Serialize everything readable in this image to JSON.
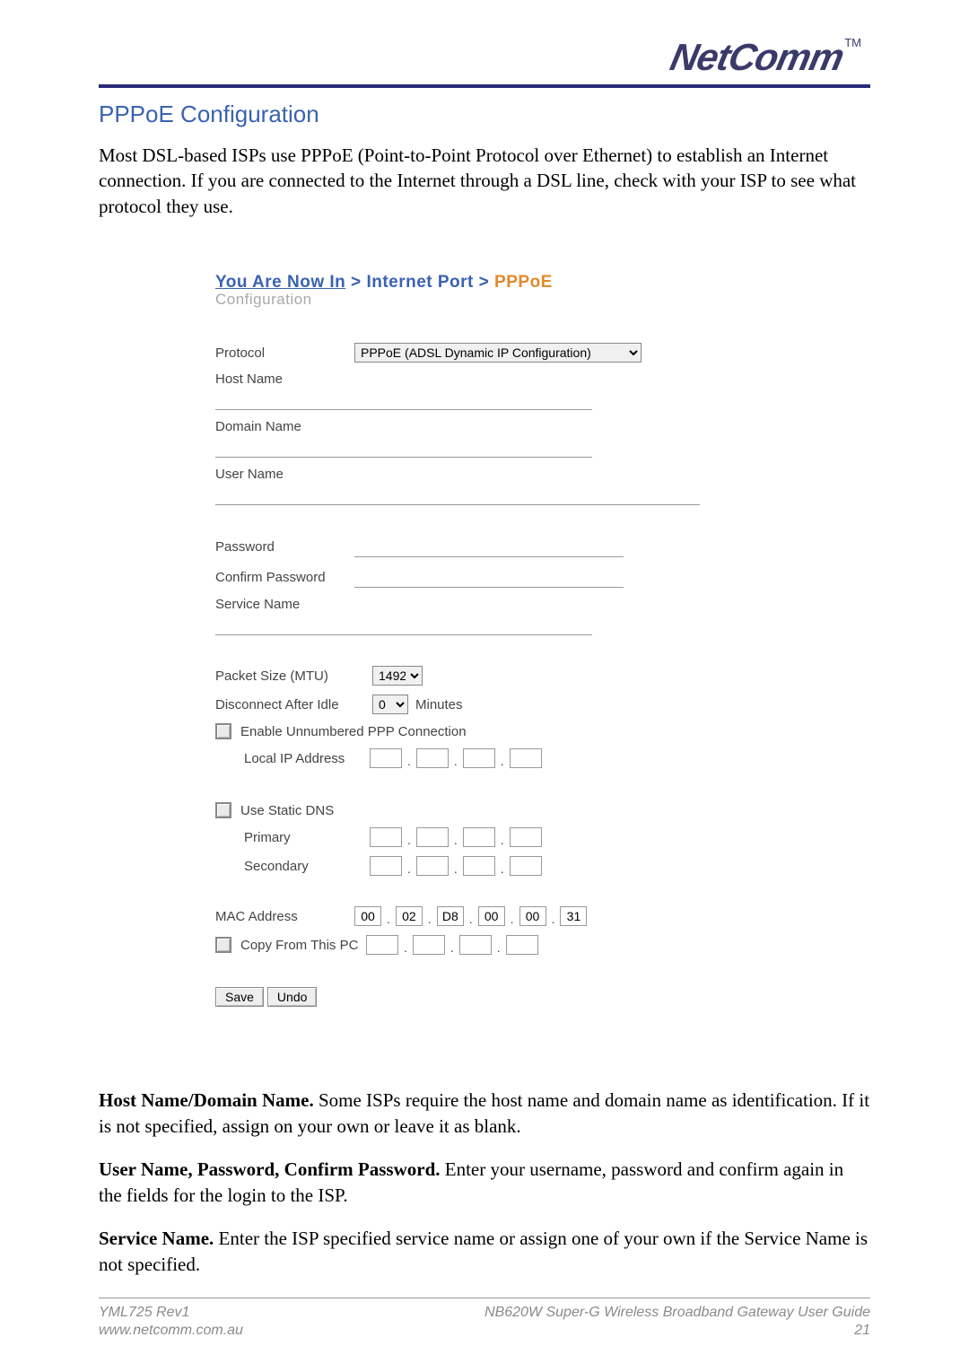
{
  "brand": {
    "name": "NetComm",
    "tm": "TM"
  },
  "section_title": "PPPoE Configuration",
  "intro_text": "Most DSL-based ISPs use PPPoE (Point-to-Point Protocol over Ethernet) to establish an Internet connection. If you are connected to the Internet through a DSL line, check with your ISP to see what protocol they use.",
  "breadcrumb": {
    "prefix_link": "You Are Now In",
    "sep": " > ",
    "part2": "Internet Port",
    "active": "PPPoE",
    "line2": "Configuration"
  },
  "form": {
    "protocol_label": "Protocol",
    "protocol_value": "PPPoE (ADSL Dynamic IP Configuration)",
    "host_name_label": "Host Name",
    "domain_name_label": "Domain Name",
    "user_name_label": "User Name",
    "password_label": "Password",
    "confirm_password_label": "Confirm Password",
    "service_name_label": "Service Name",
    "mtu_label": "Packet Size (MTU)",
    "mtu_value": "1492",
    "idle_label_pre": "Disconnect After Idle",
    "idle_value": "0",
    "idle_label_post": "Minutes",
    "enable_unnumbered_label": "Enable Unnumbered PPP Connection",
    "local_ip_label": "Local IP Address",
    "use_static_dns_label": "Use Static DNS",
    "primary_label": "Primary",
    "secondary_label": "Secondary",
    "mac_label": "MAC Address",
    "mac": [
      "00",
      "02",
      "D8",
      "00",
      "00",
      "31"
    ],
    "copy_from_pc_label": "Copy From This PC",
    "save_label": "Save",
    "undo_label": "Undo"
  },
  "body": {
    "p1_bold": "Host Name/Domain Name.",
    "p1_rest": " Some ISPs require the host name and domain name as identification.  If it is not specified, assign on your own or leave it as blank.",
    "p2_bold": "User Name, Password, Confirm Password.",
    "p2_rest": " Enter your username, password and confirm again in the fields for the login to the ISP.",
    "p3_bold": "Service Name.",
    "p3_rest": " Enter the ISP specified service name or assign one of your own if the Service Name is not specified."
  },
  "footer": {
    "rev": "YML725 Rev1",
    "url": "www.netcomm.com.au",
    "guide": "NB620W Super-G Wireless Broadband  Gateway User Guide",
    "page": "21"
  }
}
